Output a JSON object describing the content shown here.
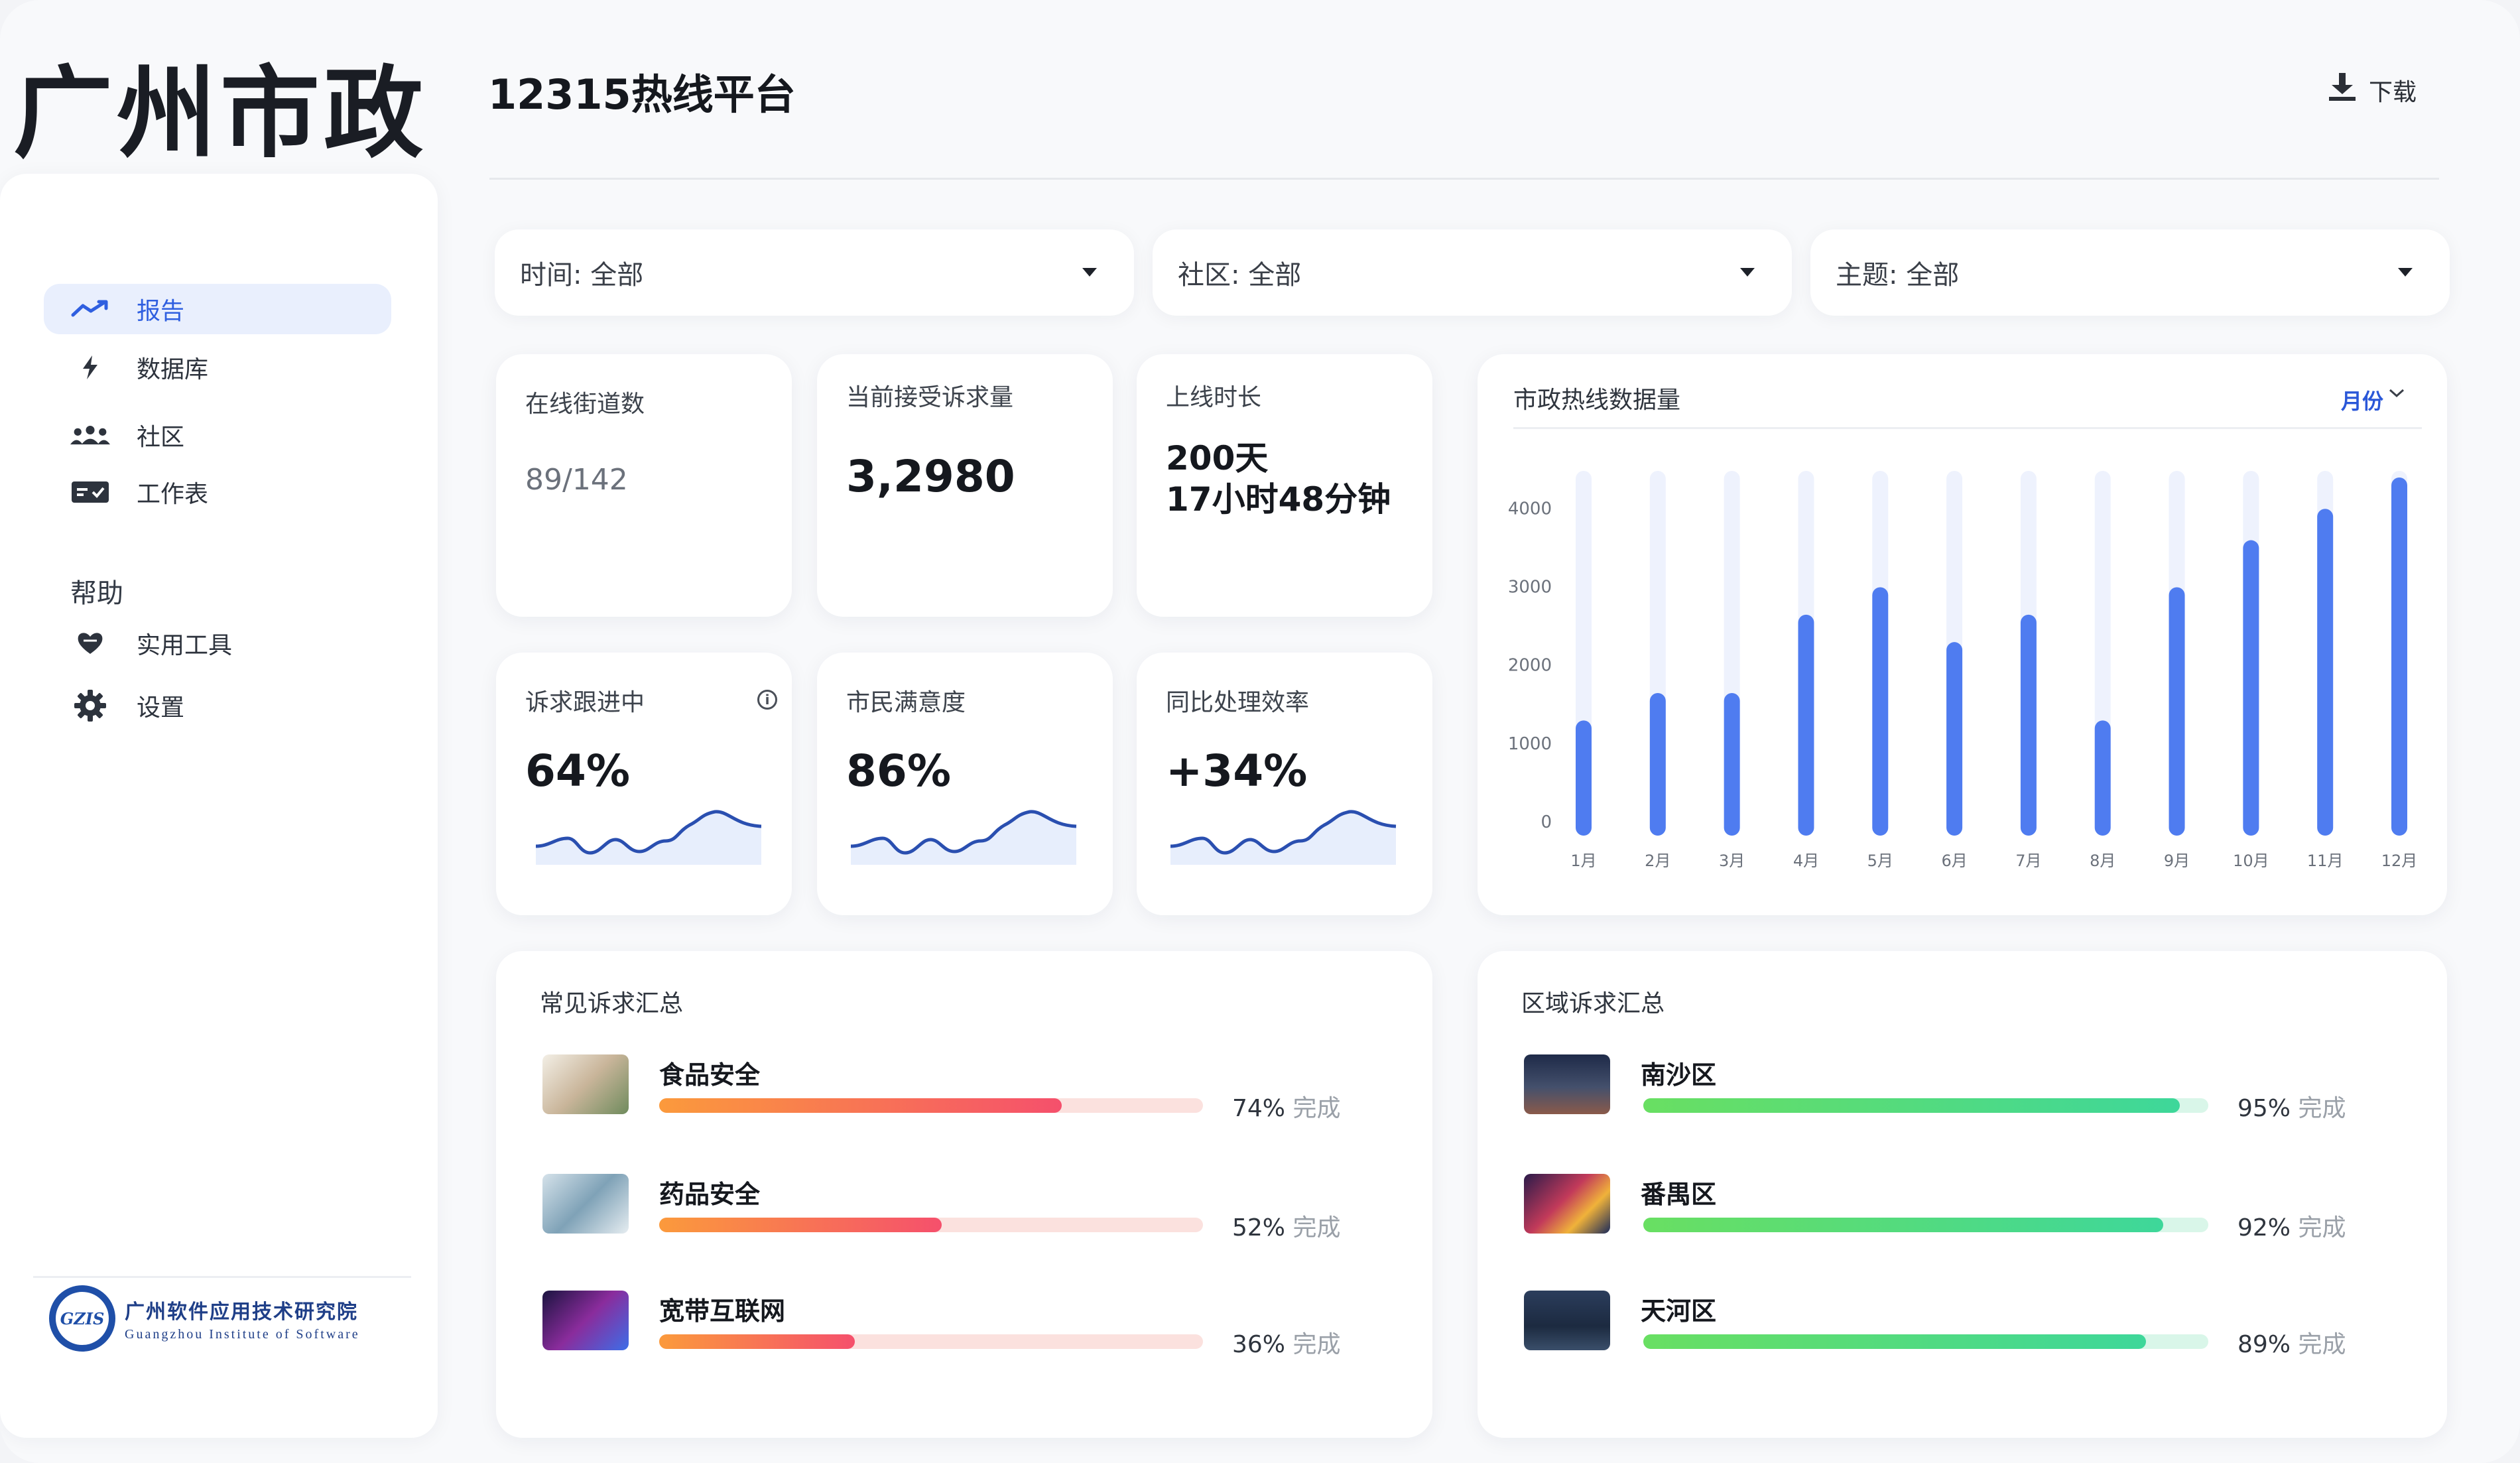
{
  "brand": "广州市政",
  "header": {
    "title": "12315热线平台",
    "download_label": "下载"
  },
  "sidebar": {
    "items": [
      {
        "label": "报告",
        "icon": "trending-up-icon",
        "active": true
      },
      {
        "label": "数据库",
        "icon": "bolt-icon"
      },
      {
        "label": "社区",
        "icon": "people-icon"
      },
      {
        "label": "工作表",
        "icon": "card-icon"
      }
    ],
    "help_section": "帮助",
    "help_items": [
      {
        "label": "实用工具",
        "icon": "heart-hands-icon"
      },
      {
        "label": "设置",
        "icon": "gear-icon"
      }
    ],
    "org": {
      "logo_text": "GZIS",
      "name": "广州软件应用技术研究院",
      "name_en": "Guangzhou Institute of Software"
    }
  },
  "filters": [
    {
      "label": "时间: 全部"
    },
    {
      "label": "社区: 全部"
    },
    {
      "label": "主题: 全部"
    }
  ],
  "stats": [
    {
      "label": "在线街道数",
      "value": "89/142"
    },
    {
      "label": "当前接受诉求量",
      "value": "3,2980"
    },
    {
      "label": "上线时长",
      "value_line1": "200天",
      "value_line2": "17小时48分钟"
    },
    {
      "label": "诉求跟进中",
      "value": "64%",
      "info_icon": "info-icon"
    },
    {
      "label": "市民满意度",
      "value": "86%"
    },
    {
      "label": "同比处理效率",
      "value": "+34%"
    }
  ],
  "chart": {
    "title": "市政热线数据量",
    "period": "月份",
    "colors": {
      "bar": "#4f7cf0",
      "track": "#eef2fd"
    }
  },
  "chart_data": {
    "type": "bar",
    "title": "市政热线数据量",
    "categories": [
      "1月",
      "2月",
      "3月",
      "4月",
      "5月",
      "6月",
      "7月",
      "8月",
      "9月",
      "10月",
      "11月",
      "12月"
    ],
    "values": [
      1300,
      1650,
      1650,
      2650,
      3000,
      2300,
      2650,
      1300,
      3000,
      3600,
      4000,
      4400
    ],
    "y_ticks": [
      0,
      1000,
      2000,
      3000,
      4000
    ],
    "ylim": [
      0,
      4400
    ],
    "grid": false,
    "legend": "none"
  },
  "common_summary": {
    "title": "常见诉求汇总",
    "done_label": "完成",
    "items": [
      {
        "name": "食品安全",
        "percent": 74,
        "percent_label": "74%"
      },
      {
        "name": "药品安全",
        "percent": 52,
        "percent_label": "52%"
      },
      {
        "name": "宽带互联网",
        "percent": 36,
        "percent_label": "36%"
      }
    ]
  },
  "region_summary": {
    "title": "区域诉求汇总",
    "done_label": "完成",
    "items": [
      {
        "name": "南沙区",
        "percent": 95,
        "percent_label": "95%"
      },
      {
        "name": "番禺区",
        "percent": 92,
        "percent_label": "92%"
      },
      {
        "name": "天河区",
        "percent": 89,
        "percent_label": "89%"
      }
    ]
  }
}
